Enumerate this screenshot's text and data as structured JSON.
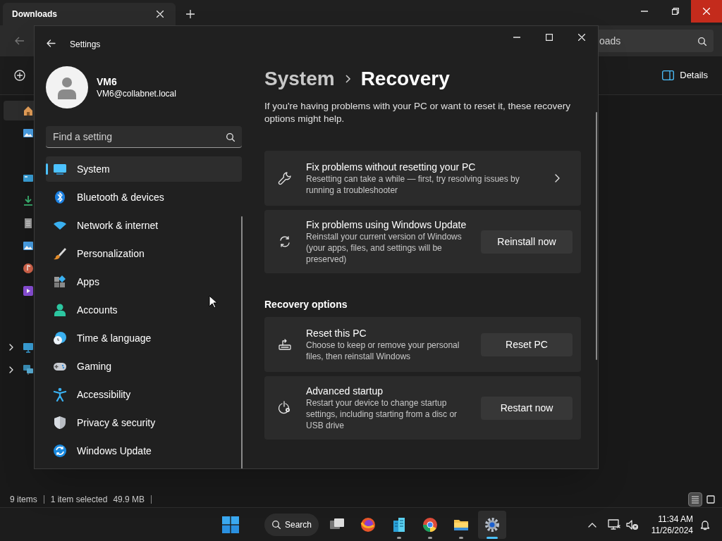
{
  "explorer": {
    "tab": {
      "title": "Downloads"
    },
    "search": {
      "value": "oads"
    },
    "toolbar": {
      "details_label": "Details"
    },
    "nav_items": [
      {
        "selected": true
      },
      {
        "selected": false
      },
      {
        "selected": false
      },
      {
        "selected": false
      },
      {
        "selected": false
      },
      {
        "selected": false
      },
      {
        "selected": false
      },
      {
        "selected": false
      }
    ],
    "tree_items": [
      {
        "expanded": false
      },
      {
        "expanded": false
      }
    ],
    "status_bar": {
      "count": "9 items",
      "selection": "1 item selected",
      "size": "49.9 MB"
    },
    "views": [
      {
        "selected": true
      },
      {
        "selected": false
      }
    ]
  },
  "settings": {
    "title": "Settings",
    "user": {
      "name": "VM6",
      "email": "VM6@collabnet.local"
    },
    "search": {
      "placeholder": "Find a setting"
    },
    "nav": [
      {
        "label": "System",
        "selected": true
      },
      {
        "label": "Bluetooth & devices",
        "selected": false
      },
      {
        "label": "Network & internet",
        "selected": false
      },
      {
        "label": "Personalization",
        "selected": false
      },
      {
        "label": "Apps",
        "selected": false
      },
      {
        "label": "Accounts",
        "selected": false
      },
      {
        "label": "Time & language",
        "selected": false
      },
      {
        "label": "Gaming",
        "selected": false
      },
      {
        "label": "Accessibility",
        "selected": false
      },
      {
        "label": "Privacy & security",
        "selected": false
      },
      {
        "label": "Windows Update",
        "selected": false
      }
    ],
    "breadcrumb": [
      "System",
      "Recovery"
    ],
    "description": "If you're having problems with your PC or want to reset it, these recovery options might help.",
    "sections": [
      {
        "cards": [
          {
            "kind": "link",
            "title": "Fix problems without resetting your PC",
            "description": "Resetting can take a while — first, try resolving issues by running a troubleshooter"
          },
          {
            "kind": "button",
            "title": "Fix problems using Windows Update",
            "description": "Reinstall your current version of Windows (your apps, files, and settings will be preserved)",
            "button": "Reinstall now"
          }
        ]
      },
      {
        "heading": "Recovery options",
        "cards": [
          {
            "kind": "button",
            "title": "Reset this PC",
            "description": "Choose to keep or remove your personal files, then reinstall Windows",
            "button": "Reset PC"
          },
          {
            "kind": "button",
            "title": "Advanced startup",
            "description": "Restart your device to change startup settings, including starting from a disc or USB drive",
            "button": "Restart now"
          }
        ]
      }
    ]
  },
  "taskbar": {
    "search_label": "Search",
    "apps": [
      {
        "running": false,
        "active": false
      },
      {
        "running": false,
        "active": false
      },
      {
        "running": true,
        "active": false
      },
      {
        "running": true,
        "active": false
      },
      {
        "running": true,
        "active": false
      },
      {
        "running": true,
        "active": true
      }
    ],
    "time": "11:34 AM",
    "date": "11/26/2024"
  }
}
